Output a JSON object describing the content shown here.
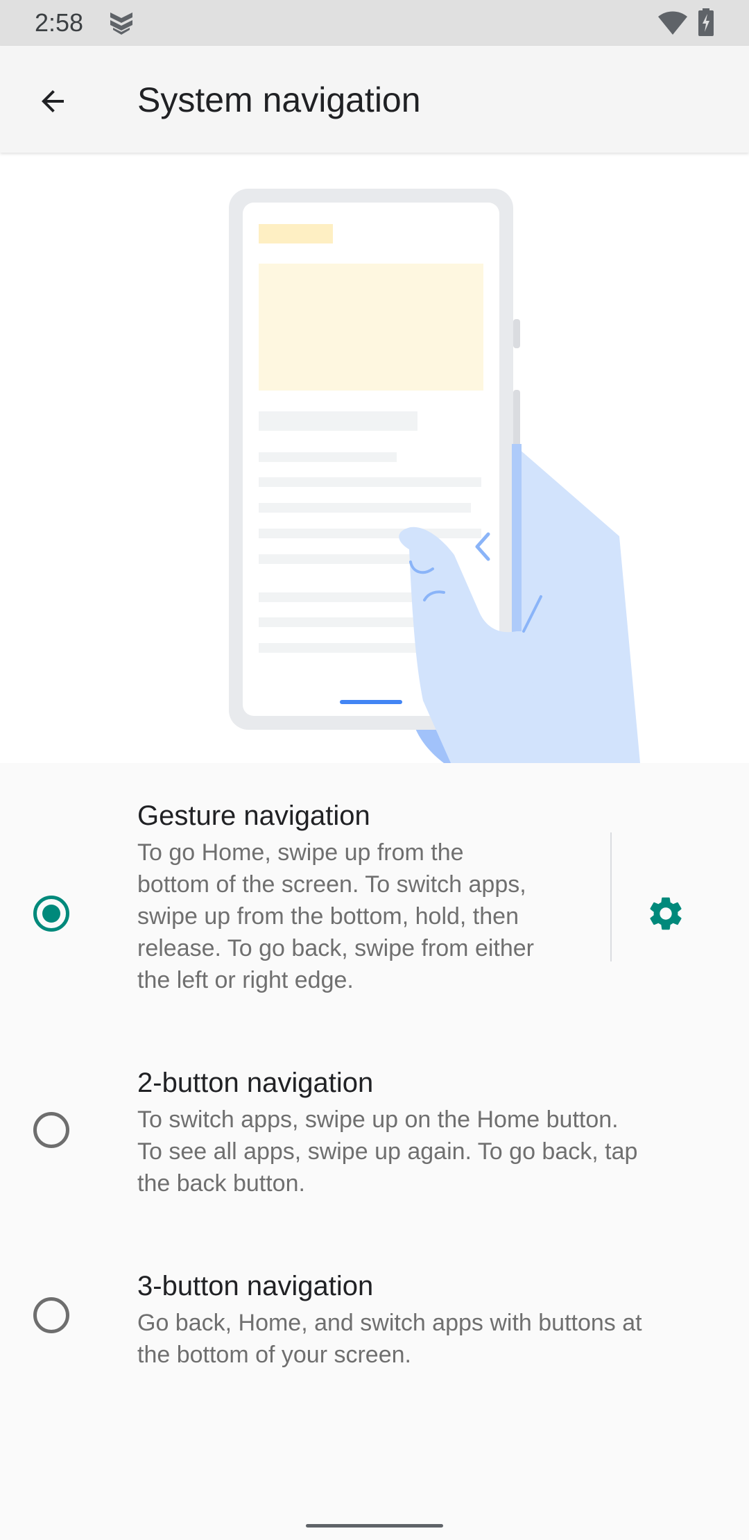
{
  "status_bar": {
    "time": "2:58",
    "icons": [
      "app-shield-icon",
      "wifi-icon",
      "battery-charging-icon"
    ]
  },
  "app_bar": {
    "title": "System navigation",
    "back_icon": "arrow-back-icon"
  },
  "options": [
    {
      "title": "Gesture navigation",
      "description_lines": [
        "To go Home, swipe up from the",
        "bottom of the screen. To switch apps,",
        "swipe up from the bottom, hold, then",
        "release. To go back, swipe from either",
        "the left or right edge."
      ],
      "selected": true,
      "has_settings": true,
      "settings_icon": "gear-icon"
    },
    {
      "title": "2-button navigation",
      "description_lines": [
        "To switch apps, swipe up on the Home button.",
        "To see all apps, swipe up again. To go back, tap",
        "the back button."
      ],
      "selected": false
    },
    {
      "title": "3-button navigation",
      "description_lines": [
        "Go back, Home, and switch apps with buttons at",
        "the bottom of your screen."
      ],
      "selected": false
    }
  ],
  "colors": {
    "accent": "#00897b",
    "hand": "#d2e3fc",
    "hand_shadow": "#aecbfa",
    "indicator": "#4285f4",
    "phone_frame": "#e8eaed",
    "placeholder_yellow": "#feefc3"
  }
}
